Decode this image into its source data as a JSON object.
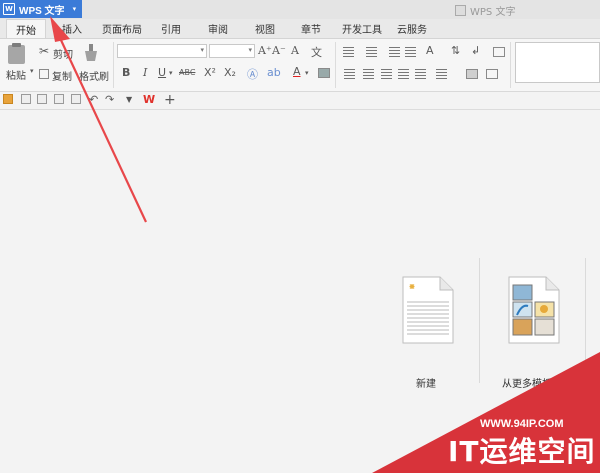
{
  "titlebar": {
    "app_button_label": "WPS 文字",
    "logo_glyph": "W",
    "window_title": "WPS 文字"
  },
  "tabs": [
    {
      "label": "开始",
      "active": true
    },
    {
      "label": "插入"
    },
    {
      "label": "页面布局"
    },
    {
      "label": "引用"
    },
    {
      "label": "审阅"
    },
    {
      "label": "视图"
    },
    {
      "label": "章节"
    },
    {
      "label": "开发工具"
    },
    {
      "label": "云服务"
    }
  ],
  "ribbon": {
    "paste_label": "粘贴",
    "cut_label": "剪切",
    "copy_label": "复制",
    "format_painter_label": "格式刷",
    "bold": "B",
    "italic": "I",
    "underline": "U",
    "strike": "ABC",
    "superscript": "X²",
    "subscript": "X₂",
    "font_color": "A",
    "grow_font": "A⁺",
    "shrink_font": "A⁻",
    "clear_format": "A",
    "phonetic": "文",
    "char_border": "A"
  },
  "start": {
    "new_label": "新建",
    "template_label": "从更多模板新"
  },
  "watermark": {
    "url": "WWW.94IP.COM",
    "text": "IT运维空间",
    "color": "#d8333a"
  },
  "colors": {
    "accent": "#3b7bd8",
    "arrow": "#e8474a"
  }
}
